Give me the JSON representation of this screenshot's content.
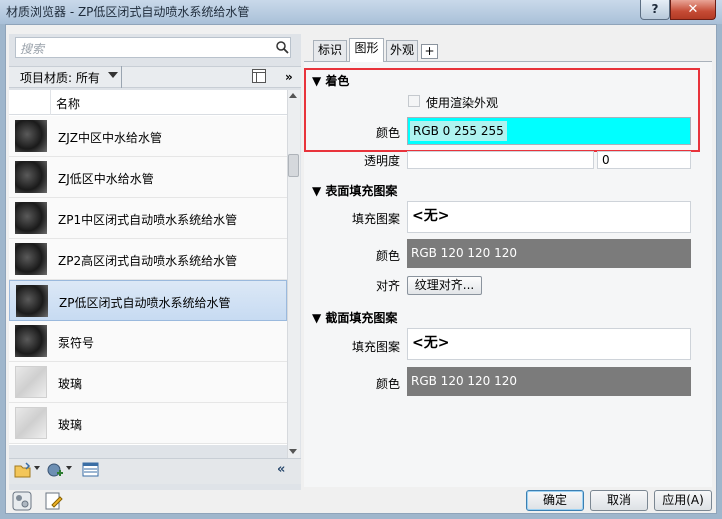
{
  "window": {
    "title": "材质浏览器 - ZP低区闭式自动喷水系统给水管",
    "help_label": "?",
    "close_label": "✕"
  },
  "search": {
    "placeholder": "搜索"
  },
  "filter": {
    "label": "项目材质: 所有",
    "collapse": "»"
  },
  "list": {
    "header": "名称",
    "items": [
      {
        "label": "ZJZ中区中水给水管",
        "thumb": "dark",
        "selected": false
      },
      {
        "label": "ZJ低区中水给水管",
        "thumb": "dark",
        "selected": false
      },
      {
        "label": "ZP1中区闭式自动喷水系统给水管",
        "thumb": "dark",
        "selected": false
      },
      {
        "label": "ZP2高区闭式自动喷水系统给水管",
        "thumb": "dark",
        "selected": false
      },
      {
        "label": "ZP低区闭式自动喷水系统给水管",
        "thumb": "dark",
        "selected": true
      },
      {
        "label": "泵符号",
        "thumb": "dark",
        "selected": false
      },
      {
        "label": "玻璃",
        "thumb": "glass",
        "selected": false
      },
      {
        "label": "玻璃",
        "thumb": "glass",
        "selected": false
      }
    ],
    "collapse": "«"
  },
  "tabs": [
    {
      "label": "标识",
      "active": false
    },
    {
      "label": "图形",
      "active": true
    },
    {
      "label": "外观",
      "active": false
    },
    {
      "label": "+",
      "active": false
    }
  ],
  "shading": {
    "title": "着色",
    "use_render_appearance": "使用渲染外观",
    "color_label": "颜色",
    "color_value": "RGB 0 255 255",
    "transparency_label": "透明度",
    "transparency_value": "0"
  },
  "surface_pattern": {
    "title": "表面填充图案",
    "pattern_label": "填充图案",
    "pattern_value": "<无>",
    "color_label": "颜色",
    "color_value": "RGB 120 120 120",
    "align_label": "对齐",
    "align_button": "纹理对齐..."
  },
  "cut_pattern": {
    "title": "截面填充图案",
    "pattern_label": "填充图案",
    "pattern_value": "<无>",
    "color_label": "颜色",
    "color_value": "RGB 120 120 120"
  },
  "footer": {
    "ok": "确定",
    "cancel": "取消",
    "apply": "应用(A)"
  },
  "colors": {
    "accent_cyan": "#00ffff",
    "highlight_red": "#e8333b",
    "pattern_gray": "#787878"
  }
}
